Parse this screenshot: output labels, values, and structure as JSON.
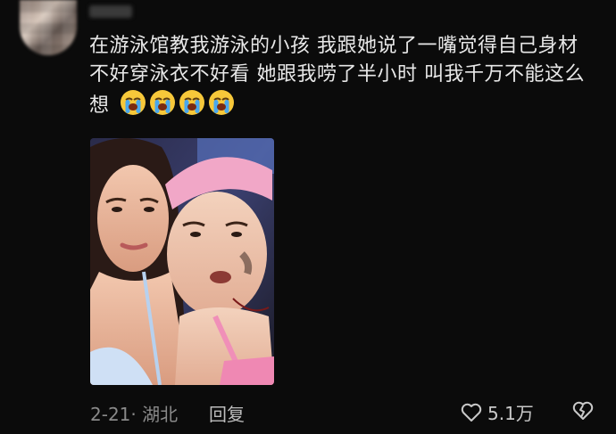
{
  "comment": {
    "text": "在游泳馆教我游泳的小孩 我跟她说了一嘴觉得自己身材不好穿泳衣不好看 她跟我唠了半小时 叫我千万不能这么想",
    "emoji_count": 4,
    "emoji_name": "loudly-crying-face-emoji",
    "meta": "2-21· 湖北",
    "reply_label": "回复",
    "like_count": "5.1万"
  },
  "colors": {
    "background": "#0b0b0b",
    "text": "#e8e8e8",
    "meta_text": "#8a8a8a"
  }
}
